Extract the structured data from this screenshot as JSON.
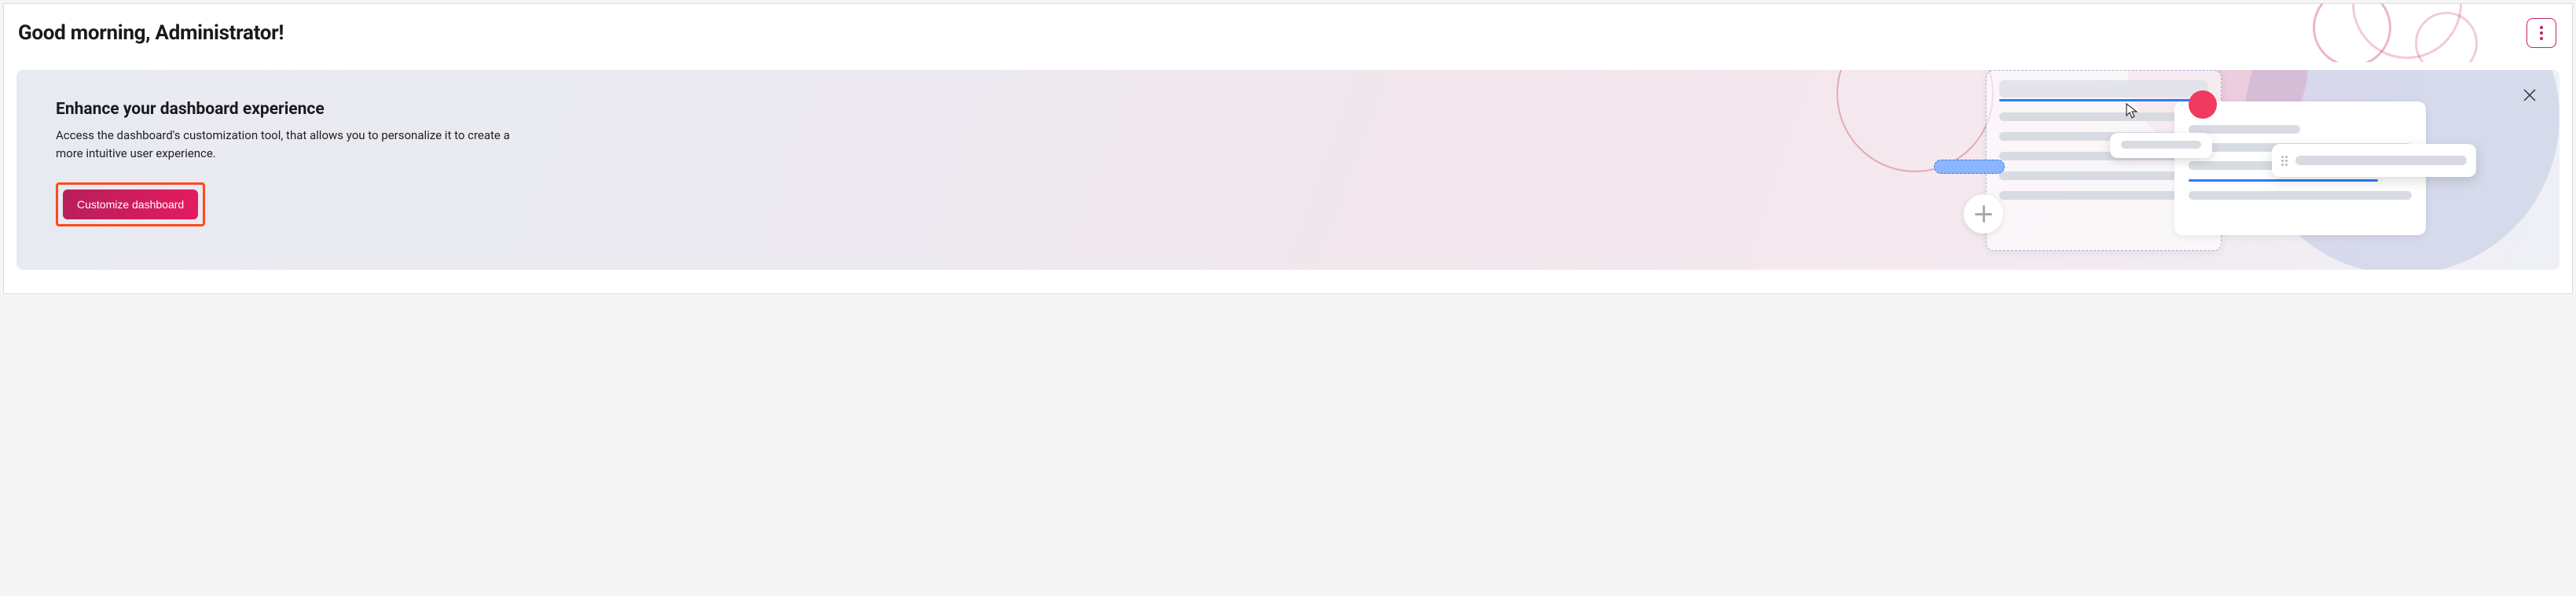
{
  "header": {
    "greeting": "Good morning, Administrator!"
  },
  "banner": {
    "title": "Enhance your dashboard experience",
    "text": "Access the dashboard's customization tool, that allows you to personalize it to create a more intuitive user experience.",
    "cta_label": "Customize dashboard"
  }
}
